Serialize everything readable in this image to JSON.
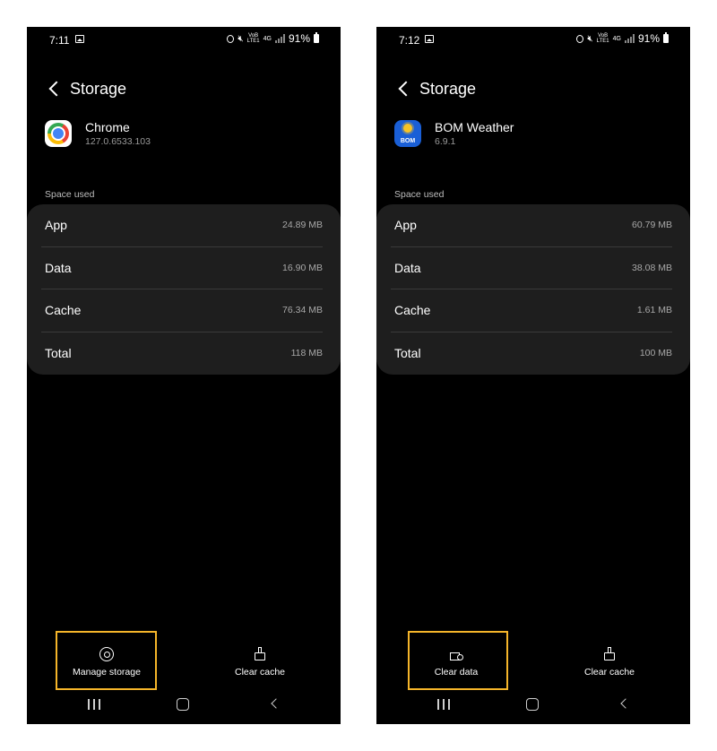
{
  "left_phone": {
    "status": {
      "time": "7:11",
      "volte": "VoB LTE1",
      "network": "4G",
      "battery": "91%"
    },
    "header": {
      "title": "Storage"
    },
    "app": {
      "name": "Chrome",
      "version": "127.0.6533.103",
      "icon": "chrome-icon"
    },
    "section_label": "Space used",
    "rows": [
      {
        "label": "App",
        "value": "24.89 MB"
      },
      {
        "label": "Data",
        "value": "16.90 MB"
      },
      {
        "label": "Cache",
        "value": "76.34 MB"
      },
      {
        "label": "Total",
        "value": "118 MB"
      }
    ],
    "actions": {
      "primary": {
        "label": "Manage storage",
        "icon": "manage-storage-icon",
        "highlighted": true
      },
      "secondary": {
        "label": "Clear cache",
        "icon": "clear-cache-icon"
      }
    }
  },
  "right_phone": {
    "status": {
      "time": "7:12",
      "volte": "VoB LTE1",
      "network": "4G",
      "battery": "91%"
    },
    "header": {
      "title": "Storage"
    },
    "app": {
      "name": "BOM Weather",
      "version": "6.9.1",
      "icon_text": "BOM",
      "icon": "bom-weather-icon"
    },
    "section_label": "Space used",
    "rows": [
      {
        "label": "App",
        "value": "60.79 MB"
      },
      {
        "label": "Data",
        "value": "38.08 MB"
      },
      {
        "label": "Cache",
        "value": "1.61 MB"
      },
      {
        "label": "Total",
        "value": "100 MB"
      }
    ],
    "actions": {
      "primary": {
        "label": "Clear data",
        "icon": "clear-data-icon",
        "highlighted": true
      },
      "secondary": {
        "label": "Clear cache",
        "icon": "clear-cache-icon"
      }
    }
  },
  "colors": {
    "highlight": "#f5b52a",
    "card": "#1e1e1e",
    "screen": "#000000"
  }
}
